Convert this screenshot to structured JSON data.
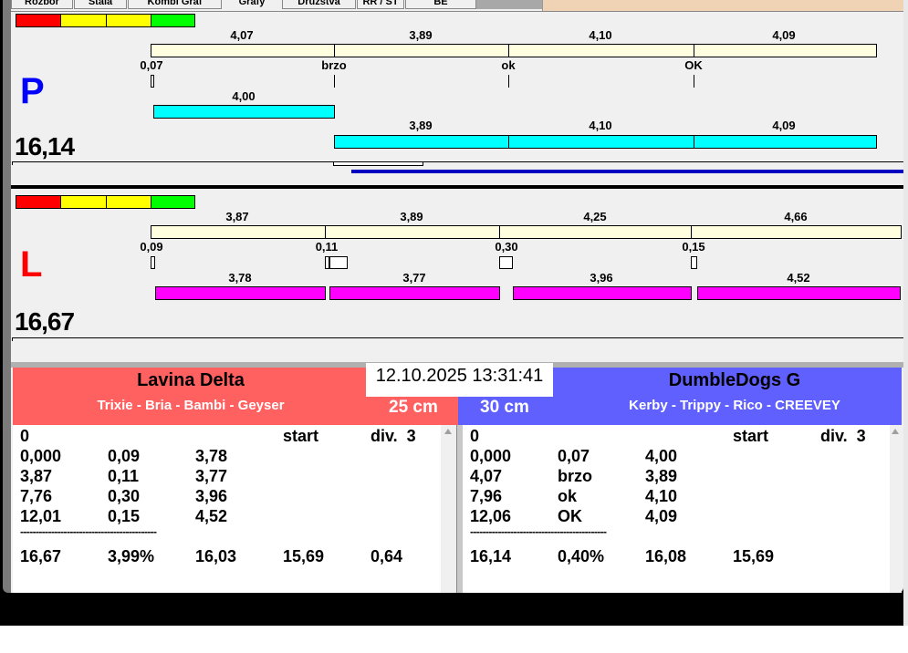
{
  "tabs": [
    "Rozbor",
    "Stala",
    "Kombi Graf",
    "Grafy",
    "Družstva",
    "RR / ST",
    "BE"
  ],
  "colors": {
    "red": "#ff0000",
    "yellow": "#ffff00",
    "green": "#00ff00",
    "bar_bg": "#ffffe0",
    "cyan": "#00ffff",
    "magenta": "#ff00ff",
    "team_left": "#ff6060",
    "team_right": "#6060ff"
  },
  "panel_p": {
    "letter": "P",
    "total": "16,14",
    "top_labels": [
      "4,07",
      "3,89",
      "4,10",
      "4,09"
    ],
    "reaction_labels": [
      "0,07",
      "brzo",
      "ok",
      "OK"
    ],
    "bar1_label": "4,00",
    "bar2_labels": [
      "3,89",
      "4,10",
      "4,09"
    ]
  },
  "panel_l": {
    "letter": "L",
    "total": "16,67",
    "top_labels": [
      "3,87",
      "3,89",
      "4,25",
      "4,66"
    ],
    "reaction_labels": [
      "0,09",
      "0,11",
      "0,30",
      "0,15"
    ],
    "bar_labels": [
      "3,78",
      "3,77",
      "3,96",
      "4,52"
    ]
  },
  "datetime": "12.10.2025 13:31:41",
  "left_team": {
    "name": "Lavina Delta",
    "dogs": "Trixie - Bria - Bambi - Geyser",
    "height": "25 cm",
    "header": [
      "0",
      "",
      "",
      "start",
      "div.  3"
    ],
    "rows": [
      [
        "0,000",
        "0,09",
        "3,78"
      ],
      [
        "3,87",
        "0,11",
        "3,77"
      ],
      [
        "7,76",
        "0,30",
        "3,96"
      ],
      [
        "12,01",
        "0,15",
        "4,52"
      ]
    ],
    "separator": "--------------------------------------------",
    "summary": [
      "16,67",
      "3,99%",
      "16,03",
      "15,69",
      "0,64"
    ]
  },
  "right_team": {
    "name": "DumbleDogs G",
    "dogs": "Kerby - Trippy - Rico - CREEVEY",
    "height": "30 cm",
    "header": [
      "0",
      "",
      "",
      "start",
      "div.  3"
    ],
    "rows": [
      [
        "0,000",
        "0,07",
        "4,00"
      ],
      [
        "4,07",
        "brzo",
        "3,89"
      ],
      [
        "7,96",
        "ok",
        "4,10"
      ],
      [
        "12,06",
        "OK",
        "4,09"
      ]
    ],
    "separator": "--------------------------------------------",
    "summary": [
      "16,14",
      "0,40%",
      "16,08",
      "15,69"
    ]
  }
}
